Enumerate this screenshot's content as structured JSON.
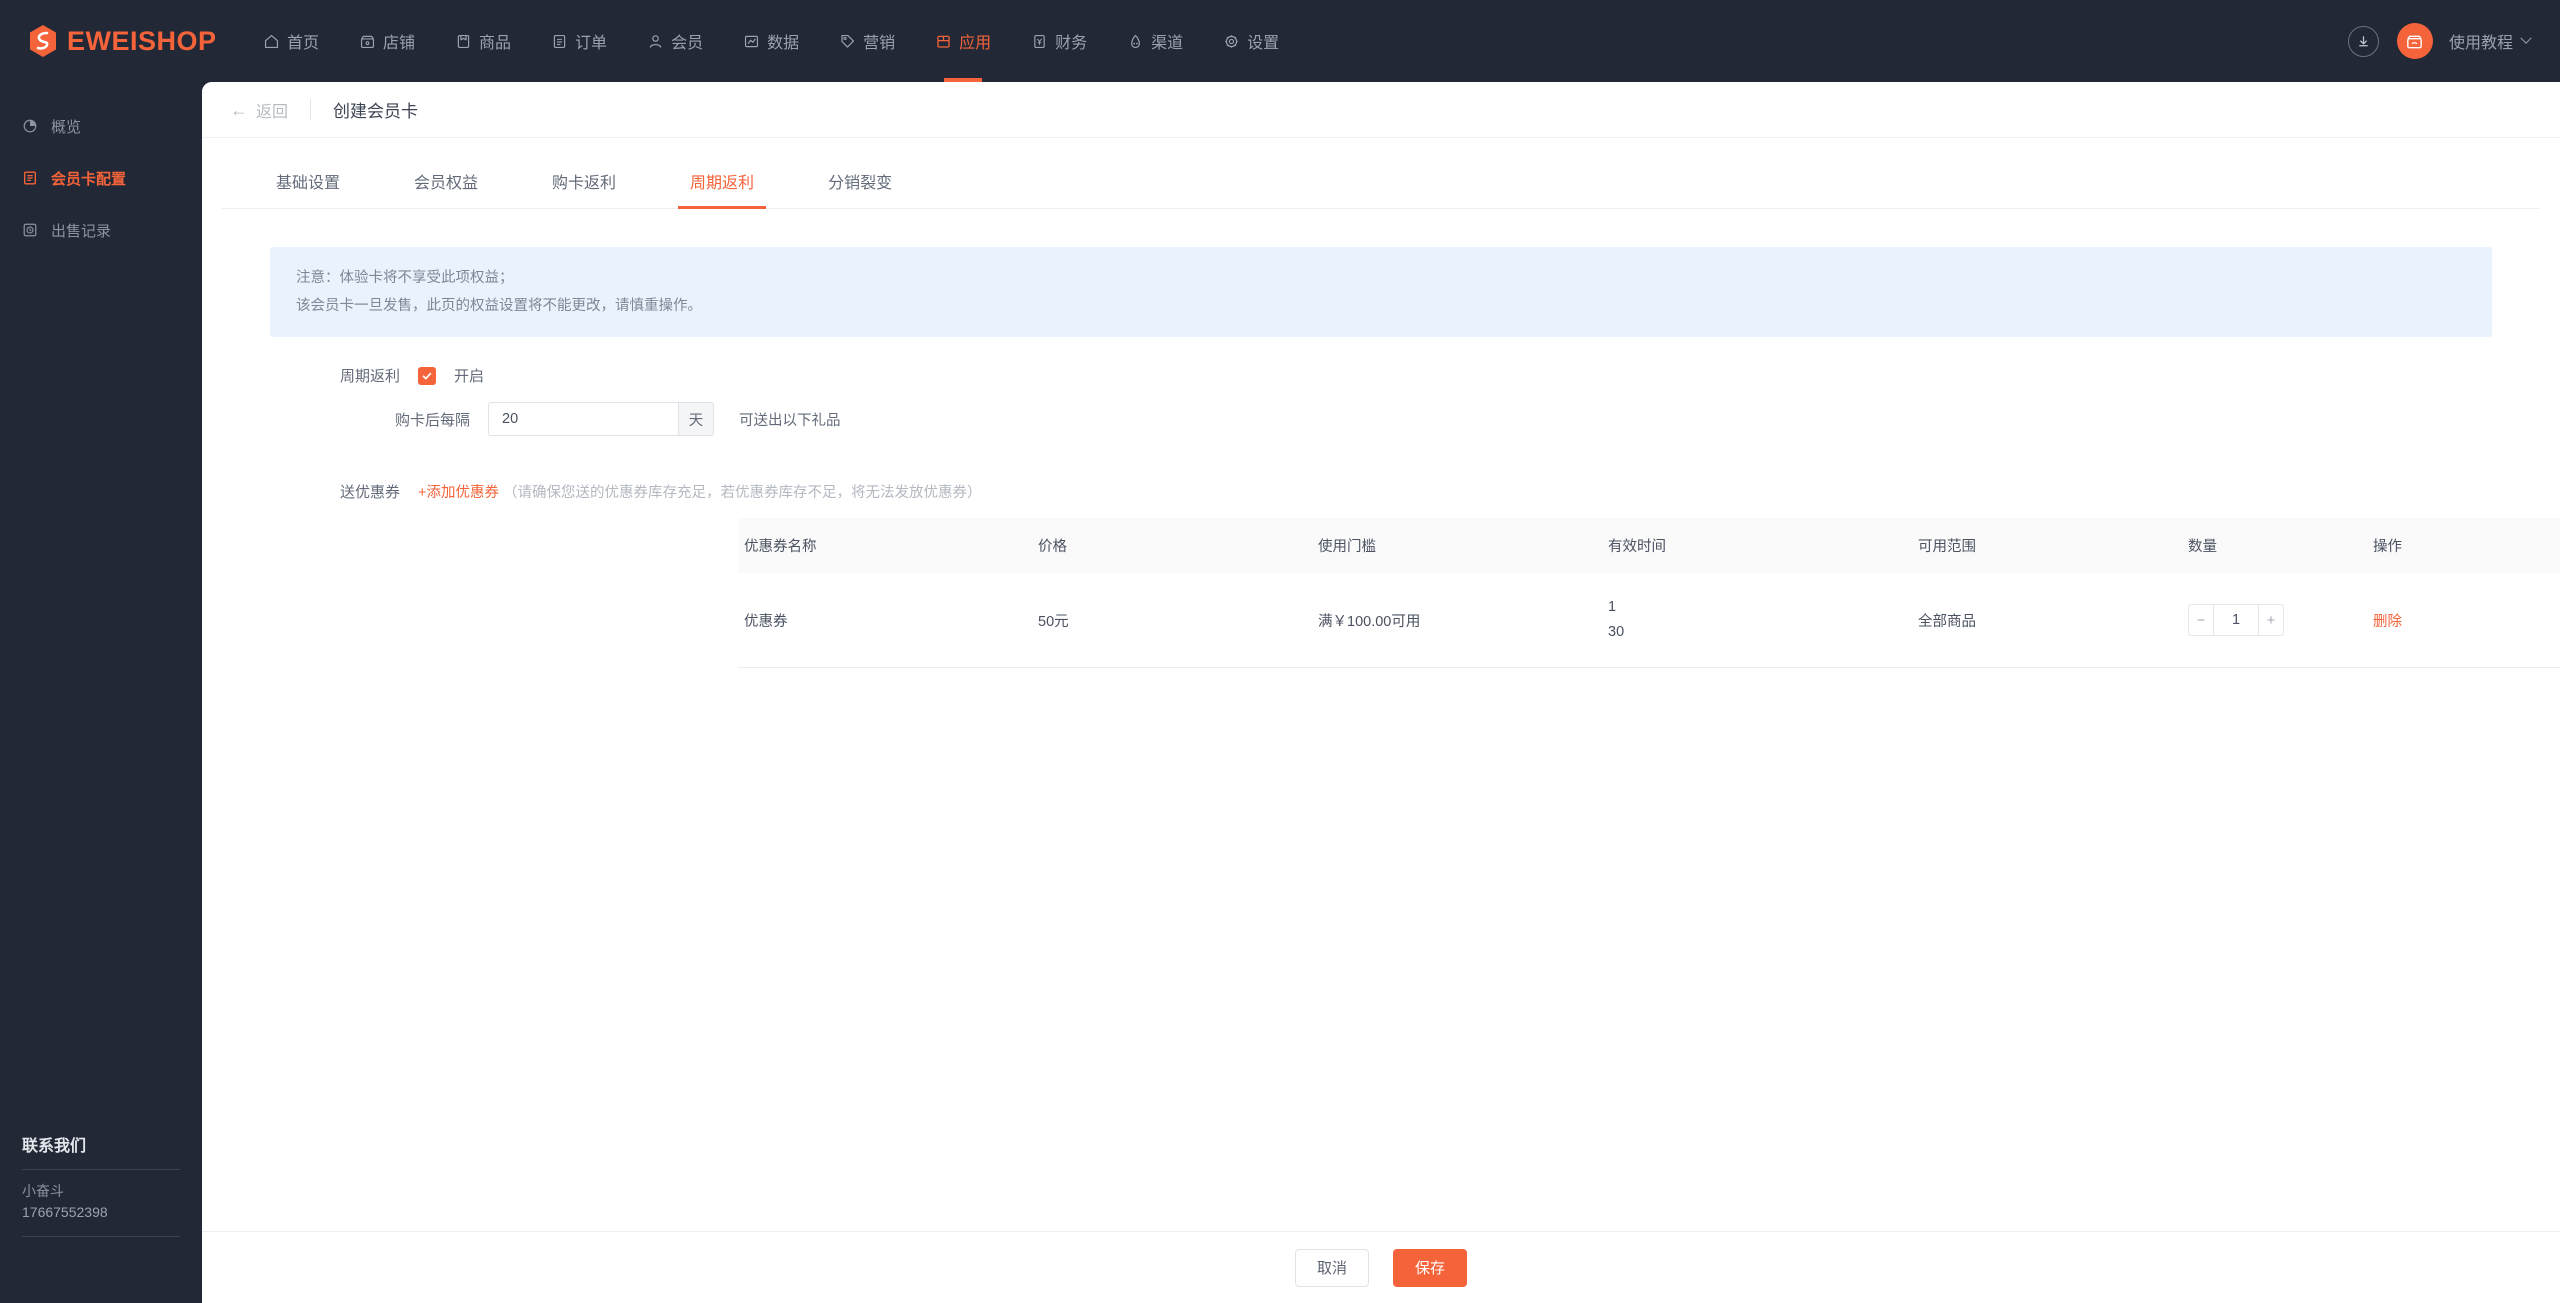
{
  "brand": {
    "name": "EWEISHOP",
    "accent": "#F4633A"
  },
  "topnav": {
    "items": [
      {
        "label": "首页",
        "icon": "home-icon",
        "active": false
      },
      {
        "label": "店铺",
        "icon": "shop-icon",
        "active": false
      },
      {
        "label": "商品",
        "icon": "goods-icon",
        "active": false
      },
      {
        "label": "订单",
        "icon": "order-icon",
        "active": false
      },
      {
        "label": "会员",
        "icon": "member-icon",
        "active": false
      },
      {
        "label": "数据",
        "icon": "chart-icon",
        "active": false
      },
      {
        "label": "营销",
        "icon": "tag-icon",
        "active": false
      },
      {
        "label": "应用",
        "icon": "apps-icon",
        "active": true
      },
      {
        "label": "财务",
        "icon": "finance-icon",
        "active": false
      },
      {
        "label": "渠道",
        "icon": "channel-icon",
        "active": false
      },
      {
        "label": "设置",
        "icon": "gear-icon",
        "active": false
      }
    ],
    "download_icon": "download-icon",
    "avatar_icon": "shop-avatar-icon",
    "tutorial_label": "使用教程"
  },
  "sidebar": {
    "items": [
      {
        "label": "概览",
        "icon": "pie-chart-icon",
        "active": false
      },
      {
        "label": "会员卡配置",
        "icon": "card-config-icon",
        "active": true
      },
      {
        "label": "出售记录",
        "icon": "record-icon",
        "active": false
      }
    ],
    "contact": {
      "title": "联系我们",
      "name": "小奋斗",
      "phone": "17667552398"
    }
  },
  "page": {
    "back_label": "返回",
    "title": "创建会员卡"
  },
  "tabs": [
    {
      "label": "基础设置",
      "active": false
    },
    {
      "label": "会员权益",
      "active": false
    },
    {
      "label": "购卡返利",
      "active": false
    },
    {
      "label": "周期返利",
      "active": true
    },
    {
      "label": "分销裂变",
      "active": false
    }
  ],
  "notice": {
    "line1": "注意：体验卡将不享受此项权益；",
    "line2": "该会员卡一旦发售，此页的权益设置将不能更改，请慎重操作。"
  },
  "form": {
    "cycle_rebate_label": "周期返利",
    "enable_label": "开启",
    "enabled": true,
    "interval_label": "购卡后每隔",
    "interval_value": "20",
    "interval_unit": "天",
    "interval_hint": "可送出以下礼品",
    "coupon_label": "送优惠券",
    "add_coupon_label": "+添加优惠券",
    "coupon_hint": "（请确保您送的优惠券库存充足，若优惠券库存不足，将无法发放优惠券）"
  },
  "table": {
    "columns": [
      "优惠券名称",
      "价格",
      "使用门槛",
      "有效时间",
      "可用范围",
      "数量",
      "操作"
    ],
    "rows": [
      {
        "name": "优惠券",
        "price": "50元",
        "threshold": "满￥100.00可用",
        "valid_line1": "1",
        "valid_line2": "30",
        "scope": "全部商品",
        "qty": "1",
        "qty_minus": "−",
        "qty_plus": "+",
        "action": "删除"
      }
    ]
  },
  "footer": {
    "cancel_label": "取消",
    "save_label": "保存"
  }
}
